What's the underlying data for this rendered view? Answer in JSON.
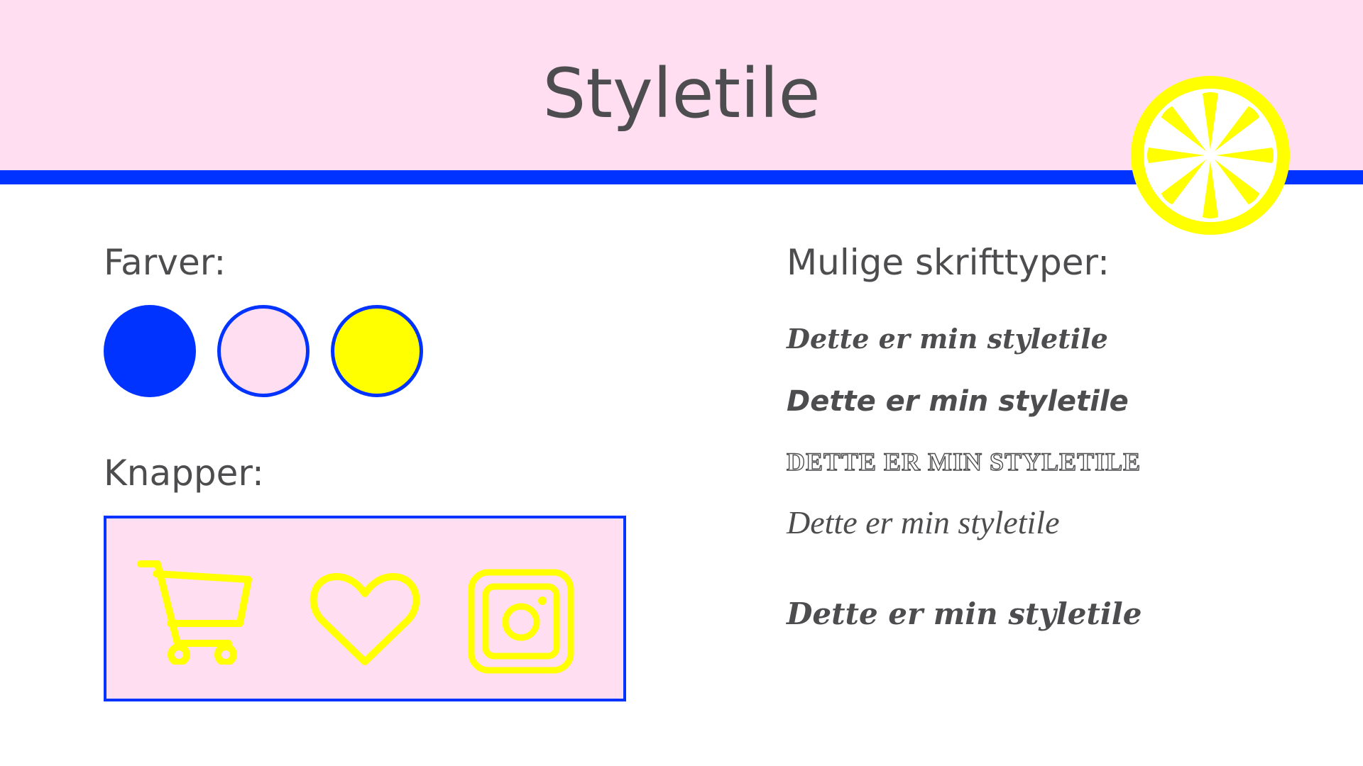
{
  "header": {
    "title": "Styletile",
    "logo_icon": "lemon-slice-icon"
  },
  "colors_section": {
    "label": "Farver:",
    "swatches": [
      "#0033ff",
      "#ffdef2",
      "#ffff00"
    ],
    "outline": "#0033ff"
  },
  "buttons_section": {
    "label": "Knapper:",
    "icons": [
      "shopping-cart-icon",
      "heart-icon",
      "instagram-icon"
    ],
    "icon_color": "#ffff00",
    "panel_bg": "#ffdef2"
  },
  "fonts_section": {
    "label": "Mulige skrifttyper:",
    "samples": [
      "Dette er min styletile",
      "Dette er min styletile",
      "DETTE ER MIN STYLETILE",
      "Dette er min styletile",
      "Dette er min styletile"
    ]
  },
  "palette": {
    "blue": "#0033ff",
    "pink": "#ffdef2",
    "yellow": "#ffff00",
    "text": "#4d4d4f"
  }
}
